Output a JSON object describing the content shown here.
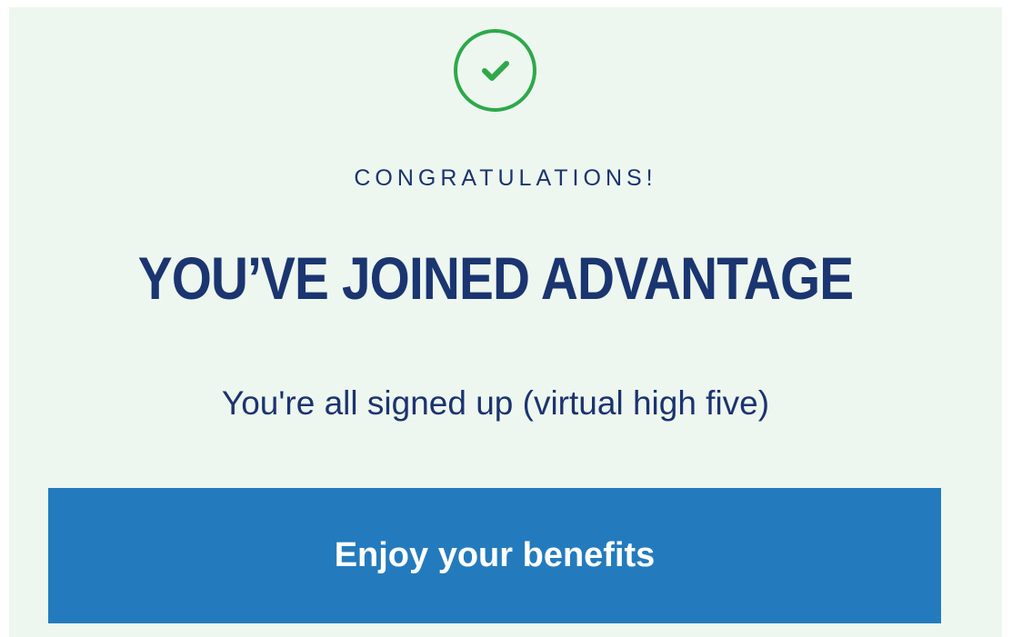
{
  "success": {
    "icon": "checkmark-circle-icon",
    "eyebrow": "CONGRATULATIONS!",
    "headline": "YOU’VE JOINED ADVANTAGE",
    "subtext": "You're all signed up (virtual high five)"
  },
  "cta": {
    "label": "Enjoy your benefits"
  },
  "colors": {
    "panel_background": "#edf7ef",
    "check_green": "#2ea84a",
    "navy_text": "#1a3570",
    "button_blue": "#237bbd",
    "button_text": "#ffffff"
  }
}
